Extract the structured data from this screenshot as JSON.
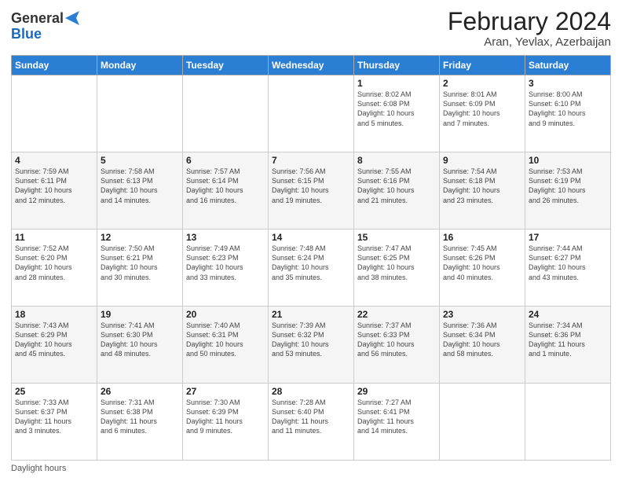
{
  "logo": {
    "general": "General",
    "blue": "Blue"
  },
  "title": "February 2024",
  "subtitle": "Aran, Yevlax, Azerbaijan",
  "days_of_week": [
    "Sunday",
    "Monday",
    "Tuesday",
    "Wednesday",
    "Thursday",
    "Friday",
    "Saturday"
  ],
  "weeks": [
    [
      {
        "num": "",
        "info": ""
      },
      {
        "num": "",
        "info": ""
      },
      {
        "num": "",
        "info": ""
      },
      {
        "num": "",
        "info": ""
      },
      {
        "num": "1",
        "info": "Sunrise: 8:02 AM\nSunset: 6:08 PM\nDaylight: 10 hours\nand 5 minutes."
      },
      {
        "num": "2",
        "info": "Sunrise: 8:01 AM\nSunset: 6:09 PM\nDaylight: 10 hours\nand 7 minutes."
      },
      {
        "num": "3",
        "info": "Sunrise: 8:00 AM\nSunset: 6:10 PM\nDaylight: 10 hours\nand 9 minutes."
      }
    ],
    [
      {
        "num": "4",
        "info": "Sunrise: 7:59 AM\nSunset: 6:11 PM\nDaylight: 10 hours\nand 12 minutes."
      },
      {
        "num": "5",
        "info": "Sunrise: 7:58 AM\nSunset: 6:13 PM\nDaylight: 10 hours\nand 14 minutes."
      },
      {
        "num": "6",
        "info": "Sunrise: 7:57 AM\nSunset: 6:14 PM\nDaylight: 10 hours\nand 16 minutes."
      },
      {
        "num": "7",
        "info": "Sunrise: 7:56 AM\nSunset: 6:15 PM\nDaylight: 10 hours\nand 19 minutes."
      },
      {
        "num": "8",
        "info": "Sunrise: 7:55 AM\nSunset: 6:16 PM\nDaylight: 10 hours\nand 21 minutes."
      },
      {
        "num": "9",
        "info": "Sunrise: 7:54 AM\nSunset: 6:18 PM\nDaylight: 10 hours\nand 23 minutes."
      },
      {
        "num": "10",
        "info": "Sunrise: 7:53 AM\nSunset: 6:19 PM\nDaylight: 10 hours\nand 26 minutes."
      }
    ],
    [
      {
        "num": "11",
        "info": "Sunrise: 7:52 AM\nSunset: 6:20 PM\nDaylight: 10 hours\nand 28 minutes."
      },
      {
        "num": "12",
        "info": "Sunrise: 7:50 AM\nSunset: 6:21 PM\nDaylight: 10 hours\nand 30 minutes."
      },
      {
        "num": "13",
        "info": "Sunrise: 7:49 AM\nSunset: 6:23 PM\nDaylight: 10 hours\nand 33 minutes."
      },
      {
        "num": "14",
        "info": "Sunrise: 7:48 AM\nSunset: 6:24 PM\nDaylight: 10 hours\nand 35 minutes."
      },
      {
        "num": "15",
        "info": "Sunrise: 7:47 AM\nSunset: 6:25 PM\nDaylight: 10 hours\nand 38 minutes."
      },
      {
        "num": "16",
        "info": "Sunrise: 7:45 AM\nSunset: 6:26 PM\nDaylight: 10 hours\nand 40 minutes."
      },
      {
        "num": "17",
        "info": "Sunrise: 7:44 AM\nSunset: 6:27 PM\nDaylight: 10 hours\nand 43 minutes."
      }
    ],
    [
      {
        "num": "18",
        "info": "Sunrise: 7:43 AM\nSunset: 6:29 PM\nDaylight: 10 hours\nand 45 minutes."
      },
      {
        "num": "19",
        "info": "Sunrise: 7:41 AM\nSunset: 6:30 PM\nDaylight: 10 hours\nand 48 minutes."
      },
      {
        "num": "20",
        "info": "Sunrise: 7:40 AM\nSunset: 6:31 PM\nDaylight: 10 hours\nand 50 minutes."
      },
      {
        "num": "21",
        "info": "Sunrise: 7:39 AM\nSunset: 6:32 PM\nDaylight: 10 hours\nand 53 minutes."
      },
      {
        "num": "22",
        "info": "Sunrise: 7:37 AM\nSunset: 6:33 PM\nDaylight: 10 hours\nand 56 minutes."
      },
      {
        "num": "23",
        "info": "Sunrise: 7:36 AM\nSunset: 6:34 PM\nDaylight: 10 hours\nand 58 minutes."
      },
      {
        "num": "24",
        "info": "Sunrise: 7:34 AM\nSunset: 6:36 PM\nDaylight: 11 hours\nand 1 minute."
      }
    ],
    [
      {
        "num": "25",
        "info": "Sunrise: 7:33 AM\nSunset: 6:37 PM\nDaylight: 11 hours\nand 3 minutes."
      },
      {
        "num": "26",
        "info": "Sunrise: 7:31 AM\nSunset: 6:38 PM\nDaylight: 11 hours\nand 6 minutes."
      },
      {
        "num": "27",
        "info": "Sunrise: 7:30 AM\nSunset: 6:39 PM\nDaylight: 11 hours\nand 9 minutes."
      },
      {
        "num": "28",
        "info": "Sunrise: 7:28 AM\nSunset: 6:40 PM\nDaylight: 11 hours\nand 11 minutes."
      },
      {
        "num": "29",
        "info": "Sunrise: 7:27 AM\nSunset: 6:41 PM\nDaylight: 11 hours\nand 14 minutes."
      },
      {
        "num": "",
        "info": ""
      },
      {
        "num": "",
        "info": ""
      }
    ]
  ],
  "footer": "Daylight hours"
}
